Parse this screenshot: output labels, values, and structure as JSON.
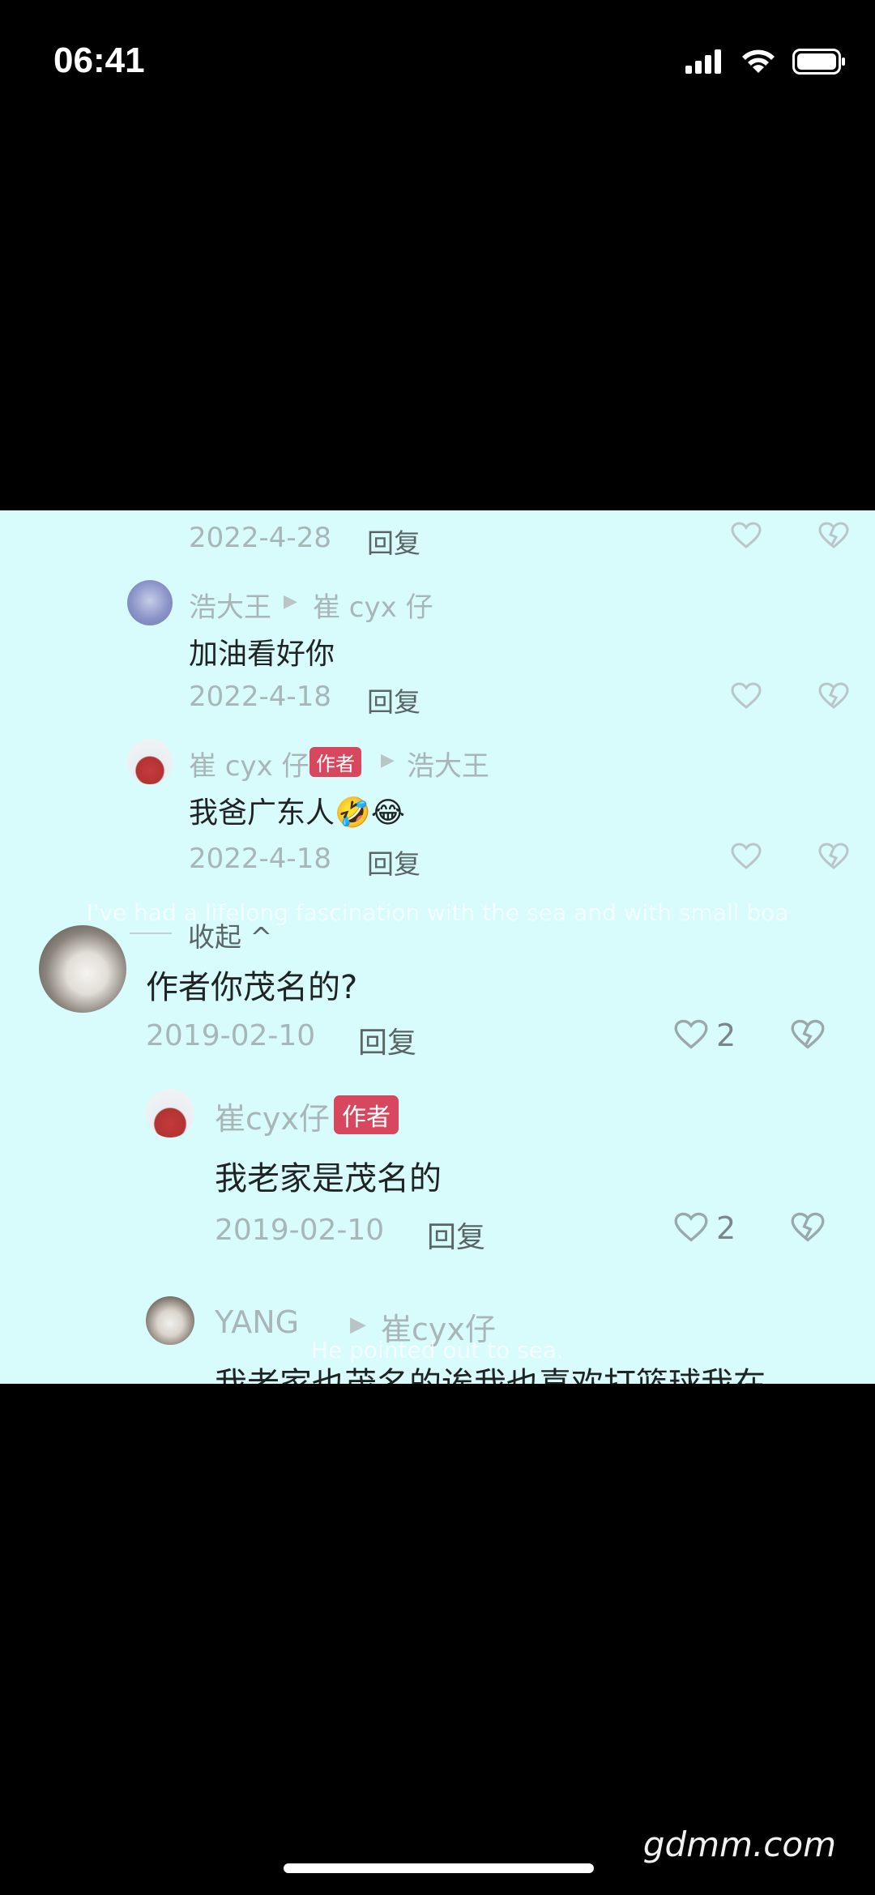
{
  "status_bar": {
    "time": "06:41"
  },
  "comments": {
    "row0": {
      "date": "2022-4-28",
      "reply": "回复"
    },
    "c1": {
      "user": "浩大王",
      "reply_to": "崔 cyx 仔",
      "text": "加油看好你",
      "date": "2022-4-18",
      "reply": "回复"
    },
    "c2": {
      "user": "崔 cyx 仔",
      "badge": "作者",
      "reply_to": "浩大王",
      "text": "我爸广东人🤣😂",
      "date": "2022-4-18",
      "reply": "回复"
    },
    "collapse": "收起 ^",
    "main": {
      "text": "作者你茂名的?",
      "date": "2019-02-10",
      "reply": "回复",
      "likes": "2"
    },
    "r1": {
      "user": "崔cyx仔",
      "badge": "作者",
      "text": "我老家是茂名的",
      "date": "2019-02-10",
      "reply": "回复",
      "likes": "2"
    },
    "r2": {
      "user": "YANG",
      "reply_to": "崔cyx仔",
      "text": "我老家也茂名的诶我也喜欢打篮球我在"
    }
  },
  "subtitles": {
    "line1": "I've had a lifelong fascination with the sea and with small boa",
    "line2": "He pointed out to sea."
  },
  "watermark": "gdmm.com",
  "colors": {
    "background": "#d8fbfb",
    "author_badge": "#d7485e"
  }
}
